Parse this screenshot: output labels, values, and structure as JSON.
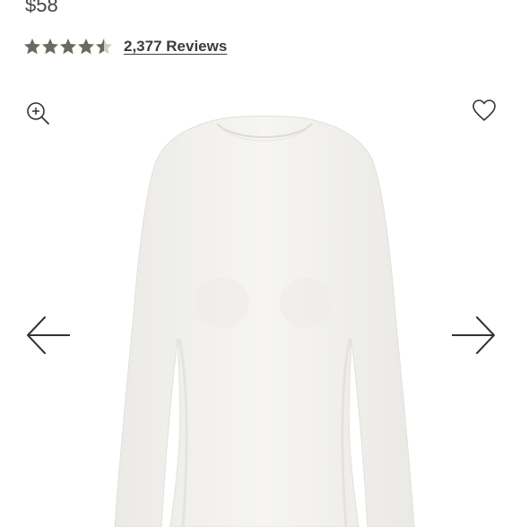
{
  "product": {
    "price": "$58",
    "rating_value": 4.5,
    "rating_max": 5,
    "reviews_label": "2,377 Reviews"
  },
  "icons": {
    "zoom": "zoom-in-icon",
    "wishlist": "heart-outline-icon",
    "prev": "arrow-left-icon",
    "next": "arrow-right-icon",
    "star": "star-icon"
  },
  "colors": {
    "star": "#6b6a5e",
    "text": "#3b3b3b",
    "garment": "#f3f2ef"
  }
}
